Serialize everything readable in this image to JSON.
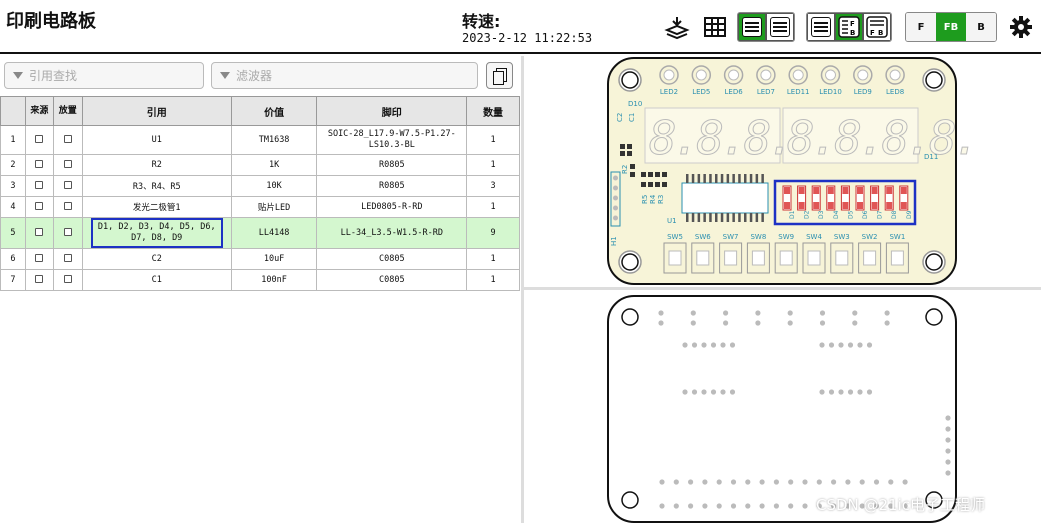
{
  "app": {
    "title": "印刷电路板"
  },
  "status": {
    "speed_label": "转速:",
    "datetime": "2023-2-12 11:22:53"
  },
  "toolbar": {
    "icons": [
      "layers-icon",
      "grid-icon",
      "list-view-icon",
      "list-alt-icon",
      "bom-only-icon",
      "bom-split-front-back-icon",
      "bom-split-icon",
      "settings-icon"
    ],
    "layer_buttons": [
      "F",
      "FB",
      "B"
    ],
    "active_layer": "FB",
    "accent": "#1e9c1e"
  },
  "filters": {
    "ref_placeholder": "引用查找",
    "filter_placeholder": "滤波器"
  },
  "table": {
    "headers": [
      "来源",
      "放置",
      "引用",
      "价值",
      "脚印",
      "数量"
    ],
    "rows": [
      {
        "n": "1",
        "ref": "U1",
        "value": "TM1638",
        "footprint": "SOIC-28_L17.9-W7.5-P1.27-LS10.3-BL",
        "qty": "1"
      },
      {
        "n": "2",
        "ref": "R2",
        "value": "1K",
        "footprint": "R0805",
        "qty": "1"
      },
      {
        "n": "3",
        "ref": "R3、R4、R5",
        "value": "10K",
        "footprint": "R0805",
        "qty": "3"
      },
      {
        "n": "4",
        "ref": "发光二极管1",
        "value": "贴片LED",
        "footprint": "LED0805-R-RD",
        "qty": "1"
      },
      {
        "n": "5",
        "ref": "D1, D2, D3, D4, D5, D6, D7, D8, D9",
        "value": "LL4148",
        "footprint": "LL-34_L3.5-W1.5-R-RD",
        "qty": "9"
      },
      {
        "n": "6",
        "ref": "C2",
        "value": "10uF",
        "footprint": "C0805",
        "qty": "1"
      },
      {
        "n": "7",
        "ref": "C1",
        "value": "100nF",
        "footprint": "C0805",
        "qty": "1"
      }
    ],
    "highlight_row": "5",
    "highlight_color": "#d4f7cf"
  },
  "pcb": {
    "front": {
      "led_labels": [
        "LED2",
        "LED5",
        "LED6",
        "LED7",
        "LED11",
        "LED10",
        "LED9",
        "LED8"
      ],
      "switch_labels": [
        "SW5",
        "SW6",
        "SW7",
        "SW8",
        "SW9",
        "SW4",
        "SW3",
        "SW2",
        "SW1"
      ],
      "diode_labels": [
        "D1",
        "D2",
        "D3",
        "D4",
        "D5",
        "D6",
        "D7",
        "D8",
        "D9"
      ],
      "labels": {
        "d10": "D10",
        "d11": "D11",
        "c2": "C2",
        "c1": "C1",
        "r2": "R2",
        "r5": "R5",
        "r4": "R4",
        "r3": "R3",
        "u1": "U1",
        "h1": "H1"
      }
    },
    "board_color": "#f7f4d8",
    "silk_color": "#2a8fb0",
    "highlight_box_color": "#1d31c4"
  },
  "watermark": "CSDN @21ic电子工程师"
}
